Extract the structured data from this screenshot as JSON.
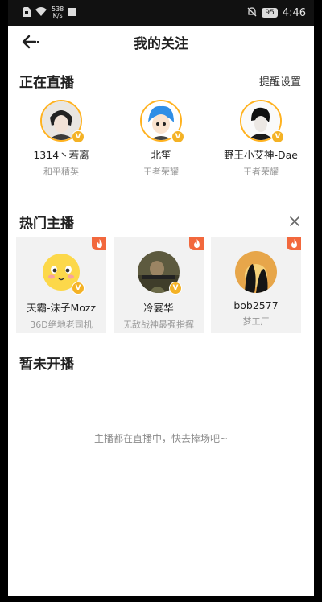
{
  "status_bar": {
    "speed_value": "538",
    "speed_unit": "K/s",
    "battery": "95",
    "time": "4:46"
  },
  "header": {
    "title": "我的关注"
  },
  "live": {
    "title": "正在直播",
    "action": "提醒设置",
    "items": [
      {
        "name": "1314丶若离",
        "game": "和平精英"
      },
      {
        "name": "北笙",
        "game": "王者荣耀"
      },
      {
        "name": "野王小艾神-Dae",
        "game": "王者荣耀"
      }
    ]
  },
  "hot": {
    "title": "热门主播",
    "items": [
      {
        "name": "天霸-沫子Mozz",
        "desc": "36D绝地老司机"
      },
      {
        "name": "冷宴华",
        "desc": "无敌战神最强指挥"
      },
      {
        "name": "bob2577",
        "desc": "梦工厂"
      }
    ]
  },
  "offline": {
    "title": "暂未开播",
    "empty_text": "主播都在直播中，快去捧场吧~"
  },
  "colors": {
    "badge": "#f4b225",
    "flame": "#f2683d",
    "ring": "#ffb21f"
  }
}
